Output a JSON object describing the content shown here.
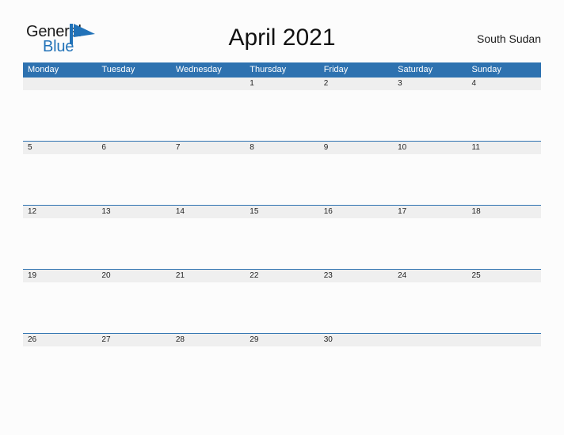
{
  "brand": {
    "name_part1": "General",
    "name_part2": "Blue",
    "flag_icon": "blue-flag-triangle",
    "color_dark": "#1a1a1a",
    "color_blue": "#2172b8"
  },
  "header": {
    "title": "April 2021",
    "country": "South Sudan"
  },
  "colors": {
    "header_blue": "#2e72b0",
    "band_gray": "#efefef",
    "page_background": "#fcfcfc",
    "text_dark": "#1f1f1f"
  },
  "calendar": {
    "month": "April",
    "year": "2021",
    "weekdays": [
      "Monday",
      "Tuesday",
      "Wednesday",
      "Thursday",
      "Friday",
      "Saturday",
      "Sunday"
    ],
    "weeks": [
      [
        "",
        "",
        "",
        "1",
        "2",
        "3",
        "4"
      ],
      [
        "5",
        "6",
        "7",
        "8",
        "9",
        "10",
        "11"
      ],
      [
        "12",
        "13",
        "14",
        "15",
        "16",
        "17",
        "18"
      ],
      [
        "19",
        "20",
        "21",
        "22",
        "23",
        "24",
        "25"
      ],
      [
        "26",
        "27",
        "28",
        "29",
        "30",
        "",
        ""
      ]
    ]
  }
}
